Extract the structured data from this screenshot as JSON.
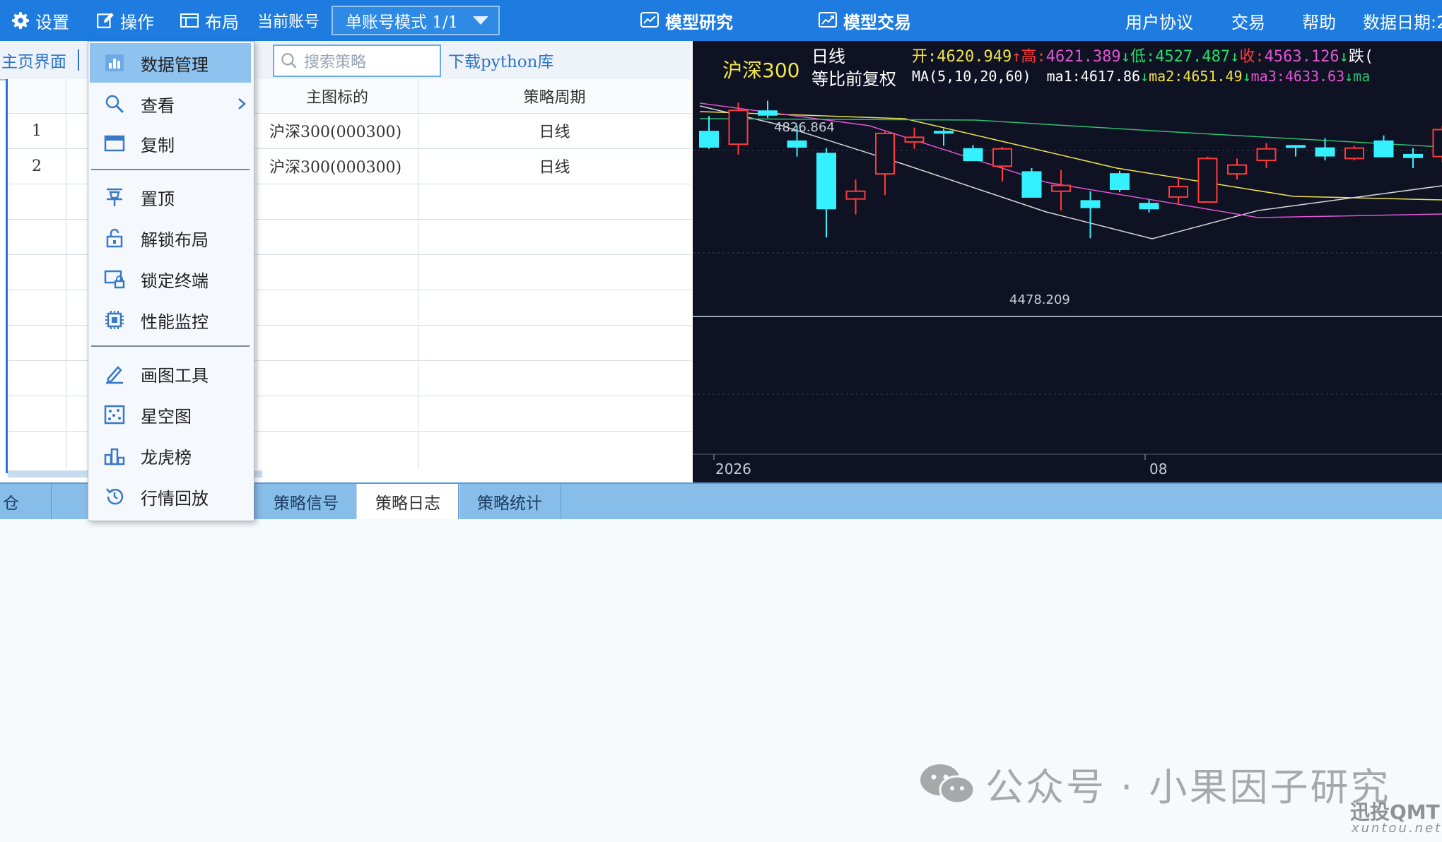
{
  "topbar": {
    "settings": "设置",
    "operate": "操作",
    "layout": "布局",
    "account_label": "当前账号",
    "account_mode": "单账号模式 1/1",
    "model_research": "模型研究",
    "model_trade": "模型交易",
    "user_agreement": "用户协议",
    "trade": "交易",
    "help": "帮助",
    "data_date": "数据日期:2"
  },
  "left": {
    "main_page": "主页界面",
    "search_placeholder": "搜索策略",
    "download_python": "下载python库",
    "columns": [
      "主图标的",
      "策略周期"
    ],
    "rows": [
      {
        "index": "1",
        "target": "沪深300(000300)",
        "period": "日线"
      },
      {
        "index": "2",
        "target": "沪深300(000300)",
        "period": "日线"
      }
    ]
  },
  "menu": {
    "items": [
      {
        "label": "数据管理",
        "icon": "bar-chart-icon"
      },
      {
        "label": "查看",
        "icon": "magnifier-icon"
      },
      {
        "label": "复制",
        "icon": "window-icon"
      },
      {
        "label": "置顶",
        "icon": "pin-icon"
      },
      {
        "label": "解锁布局",
        "icon": "unlock-icon"
      },
      {
        "label": "锁定终端",
        "icon": "lock-terminal-icon"
      },
      {
        "label": "性能监控",
        "icon": "cpu-icon"
      },
      {
        "label": "画图工具",
        "icon": "pencil-icon"
      },
      {
        "label": "星空图",
        "icon": "star-map-icon"
      },
      {
        "label": "龙虎榜",
        "icon": "ranking-icon"
      },
      {
        "label": "行情回放",
        "icon": "replay-icon"
      }
    ]
  },
  "chart_header": {
    "name": "沪深300",
    "period": "日线",
    "adjust": "等比前复权",
    "open_label": "开:",
    "open": "4620.949",
    "high_label": "高:",
    "high": "4621.389",
    "low_label": "低:",
    "low": "4527.487",
    "close_label": "收:",
    "close": "4563.126",
    "change_label": "跌(",
    "ma_label": "MA(5,10,20,60)",
    "ma1_label": "ma1:",
    "ma1": "4617.86",
    "ma2_label": "ma2:",
    "ma2": "4651.49",
    "ma3_label": "ma3:",
    "ma3": "4633.63",
    "ma4_label": "ma",
    "x_ticks": [
      "2026",
      "08"
    ]
  },
  "chart_data": {
    "type": "candlestick",
    "annotations": {
      "high_label": "4826.864",
      "low_label": "4478.209"
    },
    "candles": [
      {
        "o": 4755,
        "h": 4795,
        "l": 4710,
        "c": 4715
      },
      {
        "o": 4722,
        "h": 4830,
        "l": 4695,
        "c": 4810
      },
      {
        "o": 4808,
        "h": 4835,
        "l": 4790,
        "c": 4798
      },
      {
        "o": 4730,
        "h": 4770,
        "l": 4690,
        "c": 4715
      },
      {
        "o": 4698,
        "h": 4712,
        "l": 4480,
        "c": 4555
      },
      {
        "o": 4580,
        "h": 4630,
        "l": 4540,
        "c": 4600
      },
      {
        "o": 4645,
        "h": 4755,
        "l": 4590,
        "c": 4750
      },
      {
        "o": 4728,
        "h": 4765,
        "l": 4710,
        "c": 4740
      },
      {
        "o": 4755,
        "h": 4762,
        "l": 4718,
        "c": 4752
      },
      {
        "o": 4710,
        "h": 4720,
        "l": 4690,
        "c": 4680
      },
      {
        "o": 4665,
        "h": 4715,
        "l": 4625,
        "c": 4710
      },
      {
        "o": 4650,
        "h": 4660,
        "l": 4588,
        "c": 4585
      },
      {
        "o": 4600,
        "h": 4655,
        "l": 4550,
        "c": 4615
      },
      {
        "o": 4575,
        "h": 4600,
        "l": 4478,
        "c": 4558
      },
      {
        "o": 4645,
        "h": 4653,
        "l": 4598,
        "c": 4605
      },
      {
        "o": 4568,
        "h": 4578,
        "l": 4545,
        "c": 4555
      },
      {
        "o": 4585,
        "h": 4638,
        "l": 4565,
        "c": 4612
      },
      {
        "o": 4572,
        "h": 4690,
        "l": 4572,
        "c": 4685
      },
      {
        "o": 4645,
        "h": 4685,
        "l": 4630,
        "c": 4668
      },
      {
        "o": 4680,
        "h": 4725,
        "l": 4660,
        "c": 4710
      },
      {
        "o": 4718,
        "h": 4720,
        "l": 4690,
        "c": 4716
      },
      {
        "o": 4712,
        "h": 4738,
        "l": 4680,
        "c": 4692
      },
      {
        "o": 4685,
        "h": 4718,
        "l": 4680,
        "c": 4712
      },
      {
        "o": 4730,
        "h": 4745,
        "l": 4690,
        "c": 4690
      },
      {
        "o": 4695,
        "h": 4712,
        "l": 4660,
        "c": 4688
      },
      {
        "o": 4690,
        "h": 4770,
        "l": 4675,
        "c": 4760
      }
    ]
  },
  "tabs": [
    "仓",
    "策略信号",
    "策略日志",
    "策略统计"
  ],
  "watermark": {
    "text": "公众号 · 小果因子研究",
    "brand": "迅投QMT",
    "brand_url": "xuntou.net"
  },
  "colors": {
    "accent": "#1e7ce0",
    "up": "#ff3b3b",
    "down": "#35f0ff",
    "chart_bg": "#0f1223"
  }
}
